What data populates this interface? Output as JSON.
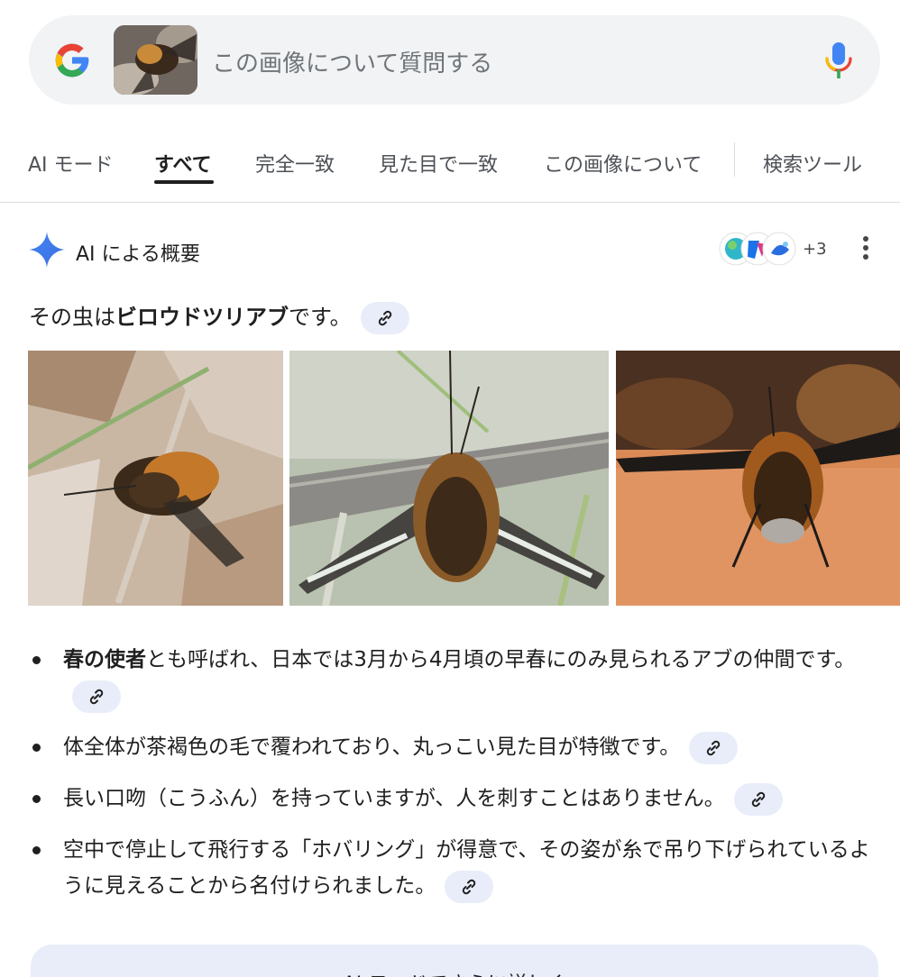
{
  "search": {
    "placeholder": "この画像について質問する",
    "logo_icon": "google-g-icon",
    "mic_icon": "microphone-icon"
  },
  "tabs": [
    {
      "label": "AI モード"
    },
    {
      "label": "すべて",
      "active": true
    },
    {
      "label": "完全一致"
    },
    {
      "label": "見た目で一致"
    },
    {
      "label": "この画像について"
    },
    {
      "label": "検索ツール"
    }
  ],
  "overview": {
    "title": "AI による概要",
    "source_count": "+3",
    "answer_prefix": "その虫は",
    "answer_bold": "ビロウドツリアブ",
    "answer_suffix": "です。",
    "bullets": [
      {
        "bold": "春の使者",
        "text": "とも呼ばれ、日本では3月から4月頃の早春にのみ見られるアブの仲間です。"
      },
      {
        "bold": "",
        "text": "体全体が茶褐色の毛で覆われており、丸っこい見た目が特徴です。"
      },
      {
        "bold": "",
        "text": "長い口吻（こうふん）を持っていますが、人を刺すことはありません。"
      },
      {
        "bold": "",
        "text": "空中で停止して飛行する「ホバリング」が得意で、その姿が糸で吊り下げられているように見えることから名付けられました。"
      }
    ],
    "more_label": "AI モードでさらに詳しく"
  },
  "colors": {
    "search_bg": "#f1f3f4",
    "chip_bg": "#e8edf9",
    "gemini_blue": "#4285f4"
  }
}
